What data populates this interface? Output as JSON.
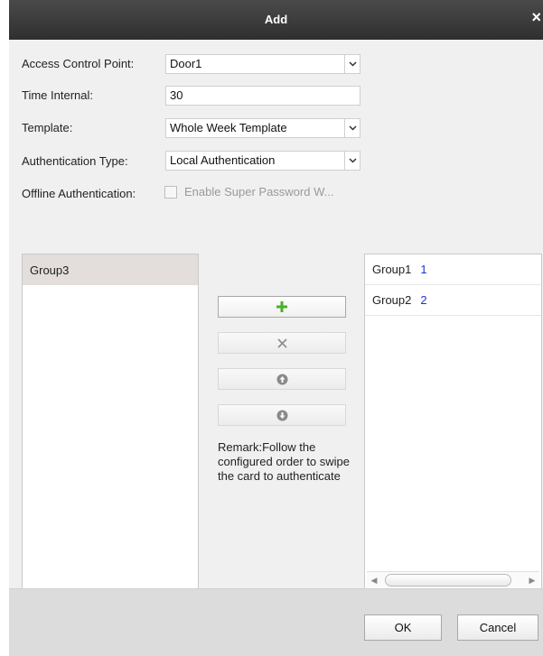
{
  "dialog": {
    "title": "Add",
    "close_glyph": "×"
  },
  "form": {
    "access_control_point": {
      "label": "Access Control Point:",
      "value": "Door1"
    },
    "time_internal": {
      "label": "Time Internal:",
      "value": "30"
    },
    "template": {
      "label": "Template:",
      "value": "Whole Week Template"
    },
    "authentication_type": {
      "label": "Authentication Type:",
      "value": "Local Authentication"
    },
    "offline_authentication": {
      "label": "Offline Authentication:",
      "checkbox_label": "Enable Super Password W...",
      "checked": false,
      "enabled": false
    }
  },
  "left_list": {
    "items": [
      {
        "label": "Group3",
        "selected": true
      }
    ]
  },
  "right_list": {
    "items": [
      {
        "label": "Group1",
        "order": "1"
      },
      {
        "label": "Group2",
        "order": "2"
      }
    ]
  },
  "actions": [
    {
      "name": "add-button",
      "icon": "plus-icon",
      "color": "#4caf2a",
      "enabled": true
    },
    {
      "name": "remove-button",
      "icon": "x-icon",
      "color": "#8a8a8a",
      "enabled": false
    },
    {
      "name": "move-up-button",
      "icon": "arrow-up-circle-icon",
      "color": "#8a8a8a",
      "enabled": false
    },
    {
      "name": "move-down-button",
      "icon": "arrow-down-circle-icon",
      "color": "#8a8a8a",
      "enabled": false
    }
  ],
  "remark": "Remark:Follow the configured order to swipe the card to authenticate",
  "footer": {
    "ok_label": "OK",
    "cancel_label": "Cancel"
  }
}
